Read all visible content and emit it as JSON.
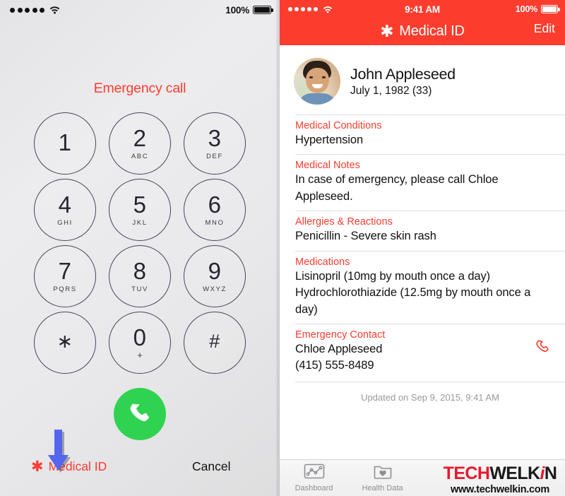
{
  "left_phone": {
    "statusbar": {
      "signal_dots": 5,
      "wifi_icon": "wifi-icon",
      "battery_pct": "100%",
      "battery_icon": "battery-full-icon"
    },
    "title": "Emergency call",
    "keypad": [
      {
        "num": "1",
        "sub": ""
      },
      {
        "num": "2",
        "sub": "ABC"
      },
      {
        "num": "3",
        "sub": "DEF"
      },
      {
        "num": "4",
        "sub": "GHI"
      },
      {
        "num": "5",
        "sub": "JKL"
      },
      {
        "num": "6",
        "sub": "MNO"
      },
      {
        "num": "7",
        "sub": "PQRS"
      },
      {
        "num": "8",
        "sub": "TUV"
      },
      {
        "num": "9",
        "sub": "WXYZ"
      },
      {
        "num": "∗",
        "sub": ""
      },
      {
        "num": "0",
        "sub": "+"
      },
      {
        "num": "#",
        "sub": ""
      }
    ],
    "call_button": {
      "icon": "phone-handset-icon",
      "color": "#30d351"
    },
    "medical_id_link": {
      "asterisk": "✱",
      "label": "Medical ID",
      "color": "#ff3b30"
    },
    "cancel_link": {
      "label": "Cancel"
    },
    "annotation": {
      "type": "arrow-down",
      "color": "#5566ee",
      "points_to": "Medical ID"
    }
  },
  "right_phone": {
    "statusbar": {
      "signal_dots": 5,
      "wifi_icon": "wifi-icon",
      "time": "9:41 AM",
      "battery_pct": "100%",
      "battery_icon": "battery-full-icon"
    },
    "nav": {
      "asterisk": "✱",
      "title": "Medical ID",
      "edit_label": "Edit",
      "bar_color": "#fc3d2e"
    },
    "profile": {
      "avatar": "user-photo-avatar",
      "name": "John Appleseed",
      "dob": "July 1, 1982 (33)"
    },
    "sections": [
      {
        "label": "Medical Conditions",
        "value": "Hypertension"
      },
      {
        "label": "Medical Notes",
        "value": "In case of emergency, please call Chloe Appleseed."
      },
      {
        "label": "Allergies & Reactions",
        "value": "Penicillin - Severe skin rash"
      },
      {
        "label": "Medications",
        "value": "Lisinopril (10mg by mouth once a day)\nHydrochlorothiazide (12.5mg by mouth once a day)"
      }
    ],
    "emergency_contact": {
      "label": "Emergency Contact",
      "name": "Chloe Appleseed",
      "phone": "(415) 555-8489",
      "call_icon": "phone-handset-outline-icon"
    },
    "updated": "Updated on Sep 9, 2015, 9:41 AM",
    "tabbar": [
      {
        "label": "Dashboard",
        "icon": "line-chart-icon"
      },
      {
        "label": "Health Data",
        "icon": "folder-heart-icon"
      }
    ]
  },
  "watermark": {
    "part1": "TECH",
    "part2": "WELK",
    "part3": "i",
    "part4": "N",
    "url": "www.techwelkin.com",
    "accent": "#e8192c"
  }
}
